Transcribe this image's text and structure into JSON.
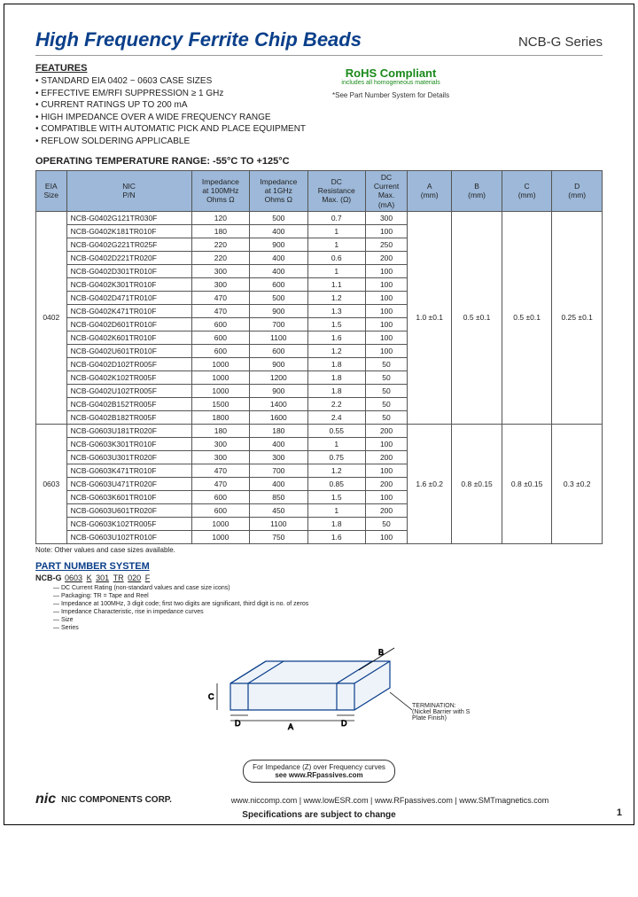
{
  "header": {
    "title": "High Frequency Ferrite Chip Beads",
    "series": "NCB-G Series"
  },
  "features": {
    "heading": "FEATURES",
    "items": [
      "STANDARD EIA 0402 ~ 0603 CASE SIZES",
      "EFFECTIVE EM/RFI SUPPRESSION ≥ 1 GHz",
      "CURRENT RATINGS UP TO 200 mA",
      "HIGH IMPEDANCE OVER A WIDE FREQUENCY RANGE",
      "COMPATIBLE WITH AUTOMATIC PICK AND PLACE EQUIPMENT",
      "REFLOW SOLDERING APPLICABLE"
    ]
  },
  "rohs": {
    "title": "RoHS Compliant",
    "sub": "includes all homogeneous materials",
    "note": "*See Part Number System for Details"
  },
  "optemp": {
    "label": "OPERATING TEMPERATURE RANGE: -55°C TO +125°C"
  },
  "table": {
    "headers": {
      "eia": "EIA\nSize",
      "pn": "NIC\nP/N",
      "z100": "Impedance\nat 100MHz\nOhms Ω",
      "z1g": "Impedance\nat 1GHz\nOhms Ω",
      "dcr": "DC\nResistance\nMax. (Ω)",
      "dcc": "DC\nCurrent\nMax.\n(mA)",
      "a": "A\n(mm)",
      "b": "B\n(mm)",
      "c": "C\n(mm)",
      "d": "D\n(mm)"
    },
    "groups": [
      {
        "size": "0402",
        "dims": {
          "a": "1.0 ±0.1",
          "b": "0.5 ±0.1",
          "c": "0.5 ±0.1",
          "d": "0.25 ±0.1"
        },
        "rows": [
          {
            "pn": "NCB-G0402G121TR030F",
            "z100": "120",
            "z1g": "500",
            "dcr": "0.7",
            "dcc": "300"
          },
          {
            "pn": "NCB-G0402K181TR010F",
            "z100": "180",
            "z1g": "400",
            "dcr": "1",
            "dcc": "100"
          },
          {
            "pn": "NCB-G0402G221TR025F",
            "z100": "220",
            "z1g": "900",
            "dcr": "1",
            "dcc": "250"
          },
          {
            "pn": "NCB-G0402D221TR020F",
            "z100": "220",
            "z1g": "400",
            "dcr": "0.6",
            "dcc": "200"
          },
          {
            "pn": "NCB-G0402D301TR010F",
            "z100": "300",
            "z1g": "400",
            "dcr": "1",
            "dcc": "100"
          },
          {
            "pn": "NCB-G0402K301TR010F",
            "z100": "300",
            "z1g": "600",
            "dcr": "1.1",
            "dcc": "100"
          },
          {
            "pn": "NCB-G0402D471TR010F",
            "z100": "470",
            "z1g": "500",
            "dcr": "1.2",
            "dcc": "100"
          },
          {
            "pn": "NCB-G0402K471TR010F",
            "z100": "470",
            "z1g": "900",
            "dcr": "1.3",
            "dcc": "100"
          },
          {
            "pn": "NCB-G0402D601TR010F",
            "z100": "600",
            "z1g": "700",
            "dcr": "1.5",
            "dcc": "100"
          },
          {
            "pn": "NCB-G0402K601TR010F",
            "z100": "600",
            "z1g": "1100",
            "dcr": "1.6",
            "dcc": "100"
          },
          {
            "pn": "NCB-G0402U601TR010F",
            "z100": "600",
            "z1g": "600",
            "dcr": "1.2",
            "dcc": "100"
          },
          {
            "pn": "NCB-G0402D102TR005F",
            "z100": "1000",
            "z1g": "900",
            "dcr": "1.8",
            "dcc": "50"
          },
          {
            "pn": "NCB-G0402K102TR005F",
            "z100": "1000",
            "z1g": "1200",
            "dcr": "1.8",
            "dcc": "50"
          },
          {
            "pn": "NCB-G0402U102TR005F",
            "z100": "1000",
            "z1g": "900",
            "dcr": "1.8",
            "dcc": "50"
          },
          {
            "pn": "NCB-G0402B152TR005F",
            "z100": "1500",
            "z1g": "1400",
            "dcr": "2.2",
            "dcc": "50"
          },
          {
            "pn": "NCB-G0402B182TR005F",
            "z100": "1800",
            "z1g": "1600",
            "dcr": "2.4",
            "dcc": "50"
          }
        ]
      },
      {
        "size": "0603",
        "dims": {
          "a": "1.6 ±0.2",
          "b": "0.8 ±0.15",
          "c": "0.8 ±0.15",
          "d": "0.3 ±0.2"
        },
        "rows": [
          {
            "pn": "NCB-G0603U181TR020F",
            "z100": "180",
            "z1g": "180",
            "dcr": "0.55",
            "dcc": "200"
          },
          {
            "pn": "NCB-G0603K301TR010F",
            "z100": "300",
            "z1g": "400",
            "dcr": "1",
            "dcc": "100"
          },
          {
            "pn": "NCB-G0603U301TR020F",
            "z100": "300",
            "z1g": "300",
            "dcr": "0.75",
            "dcc": "200"
          },
          {
            "pn": "NCB-G0603K471TR010F",
            "z100": "470",
            "z1g": "700",
            "dcr": "1.2",
            "dcc": "100"
          },
          {
            "pn": "NCB-G0603U471TR020F",
            "z100": "470",
            "z1g": "400",
            "dcr": "0.85",
            "dcc": "200"
          },
          {
            "pn": "NCB-G0603K601TR010F",
            "z100": "600",
            "z1g": "850",
            "dcr": "1.5",
            "dcc": "100"
          },
          {
            "pn": "NCB-G0603U601TR020F",
            "z100": "600",
            "z1g": "450",
            "dcr": "1",
            "dcc": "200"
          },
          {
            "pn": "NCB-G0603K102TR005F",
            "z100": "1000",
            "z1g": "1100",
            "dcr": "1.8",
            "dcc": "50"
          },
          {
            "pn": "NCB-G0603U102TR010F",
            "z100": "1000",
            "z1g": "750",
            "dcr": "1.6",
            "dcc": "100"
          }
        ]
      }
    ],
    "note": "Note: Other values and case sizes available."
  },
  "pns": {
    "title": "PART NUMBER SYSTEM",
    "parts": [
      "NCB-G",
      "0603",
      "K",
      "301",
      "TR",
      "020",
      "F"
    ],
    "labels": [
      "DC Current Rating (non-standard values and case size icons)",
      "Packaging: TR = Tape and Reel",
      "Impedance at 100MHz, 3 digit code; first two digits are significant, third digit is no. of zeros",
      "Impedance Characteristic, rise in impedance curves",
      "Size",
      "Series"
    ]
  },
  "diagram": {
    "labels": {
      "a": "A",
      "b": "B",
      "c": "C",
      "d": "D"
    },
    "termination": "TERMINATION:\n(Nickel Barrier\nwith Sn Plate Finish)"
  },
  "impnote": {
    "line1": "For Impedance (Z) over Frequency curves",
    "line2": "see www.RFpassives.com"
  },
  "footer": {
    "logo": "nic",
    "corp": "NIC COMPONENTS CORP.",
    "sites": [
      "www.niccomp.com",
      "www.lowESR.com",
      "www.RFpassives.com",
      "www.SMTmagnetics.com"
    ],
    "note": "Specifications are subject to change",
    "page": "1"
  }
}
